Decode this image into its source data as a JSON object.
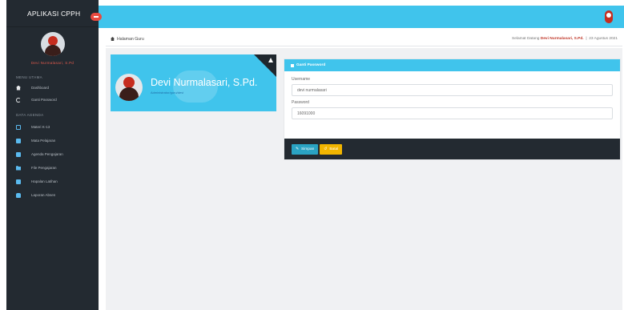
{
  "sidebar": {
    "app_title": "APLIKASI CPPH",
    "user_name": "Devi Nurmalasari, S.Pd",
    "sections": [
      {
        "label": "MENU UTAMA",
        "items": [
          {
            "label": "Dashboard",
            "icon": "home-icon"
          },
          {
            "label": "Ganti Password",
            "icon": "refresh-icon"
          }
        ]
      },
      {
        "label": "DATA AGENDA",
        "items": [
          {
            "label": "Materi K-13",
            "icon": "folder-icon"
          },
          {
            "label": "Mata Pelajaran",
            "icon": "book-icon"
          },
          {
            "label": "Agenda Pengajaran",
            "icon": "calendar-icon"
          },
          {
            "label": "File Pengajaran",
            "icon": "folder-icon"
          },
          {
            "label": "Hapalan Latihan",
            "icon": "calendar-icon"
          },
          {
            "label": "Laporan Absen",
            "icon": "car-icon"
          }
        ]
      }
    ]
  },
  "breadcrumb": {
    "label": "Halaman Guru"
  },
  "welcome": {
    "prefix": "Selamat Datang",
    "name": "Devi Nurmalasari, S.Pd.",
    "date": "23 Agustus 2021"
  },
  "profile": {
    "name": "Devi Nurmalasari, S.Pd.",
    "role": "Administrator/guru/devi"
  },
  "form": {
    "title": "Ganti Password",
    "username_label": "Username",
    "username_value": "devi nurmalasari",
    "password_label": "Password",
    "password_value": "16091000",
    "save_label": "Simpan",
    "reset_label": "Batal"
  },
  "colors": {
    "accent": "#40c4ec",
    "sidebar": "#232a31",
    "danger": "#c0392b",
    "warning": "#f1b500"
  }
}
